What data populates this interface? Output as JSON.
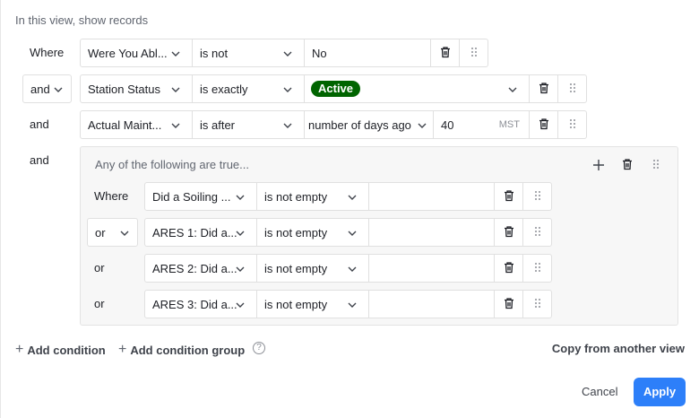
{
  "header": {
    "text": "In this view, show records"
  },
  "conditions": [
    {
      "conjunction": "Where",
      "field": "Were You Abl...",
      "operator": "is not",
      "value": "No"
    },
    {
      "conjunction": "and",
      "field": "Station Status",
      "operator": "is exactly",
      "value_badge": "Active",
      "badge_color": "#006400"
    },
    {
      "conjunction": "and",
      "field": "Actual Maint...",
      "operator": "is after",
      "value_mode": "number of days ago",
      "value": "40",
      "timezone": "MST"
    }
  ],
  "group": {
    "conjunction": "and",
    "title": "Any of the following are true...",
    "conditions": [
      {
        "conjunction": "Where",
        "field": "Did a Soiling ...",
        "operator": "is not empty"
      },
      {
        "conjunction": "or",
        "field": "ARES 1: Did a...",
        "operator": "is not empty"
      },
      {
        "conjunction": "or",
        "field": "ARES 2: Did a...",
        "operator": "is not empty"
      },
      {
        "conjunction": "or",
        "field": "ARES 3: Did a...",
        "operator": "is not empty"
      }
    ]
  },
  "footer": {
    "add_condition": "Add condition",
    "add_group": "Add condition group",
    "help": "?",
    "copy": "Copy from another view",
    "cancel": "Cancel",
    "apply": "Apply"
  },
  "colors": {
    "accent": "#2d7ff9",
    "badge_green": "#006400"
  }
}
